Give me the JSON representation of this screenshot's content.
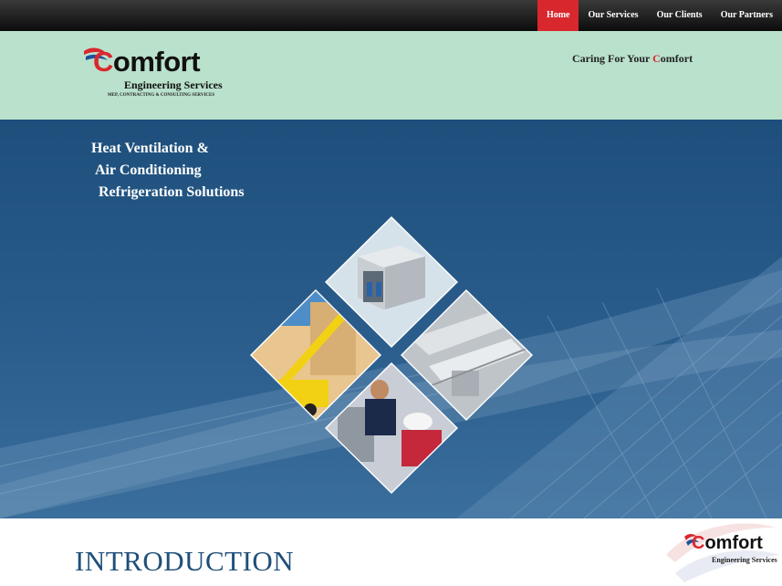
{
  "nav": {
    "items": [
      {
        "label": "Home",
        "active": true
      },
      {
        "label": "Our Services",
        "active": false
      },
      {
        "label": "Our Clients",
        "active": false
      },
      {
        "label": "Our Partners",
        "active": false
      }
    ]
  },
  "header": {
    "logo_word_c": "C",
    "logo_word_rest": "omfort",
    "logo_subtitle": "Engineering Services",
    "logo_tagline": "MEP, CONTRACTING & CONSULTING SERVICES",
    "tagline_pre": "Caring For Your ",
    "tagline_c": "C",
    "tagline_post": "omfort"
  },
  "hero": {
    "line1": "Heat Ventilation &",
    "line2": "Air Conditioning",
    "line3": "Refrigeration Solutions"
  },
  "intro": {
    "title": "INTRODUCTION"
  },
  "corner_logo": {
    "word_c": "C",
    "word_rest": "omfort",
    "subtitle": "Engineering Services"
  },
  "colors": {
    "accent_red": "#d9272e",
    "header_green": "#b9e1cb",
    "hero_blue": "#2a5d8c",
    "intro_blue": "#1f4f7a"
  }
}
